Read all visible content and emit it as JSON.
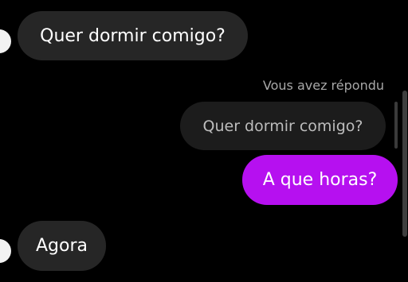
{
  "thread": {
    "messages": [
      {
        "sender": "other",
        "text": "Quer dormir comigo?"
      },
      {
        "sender": "me",
        "reply_label": "Vous avez répondu",
        "quoted_text": "Quer dormir comigo?",
        "text": "A que horas?",
        "bubble_color": "#b610f0"
      },
      {
        "sender": "other",
        "text": "Agora"
      }
    ]
  },
  "colors": {
    "background": "#000000",
    "received_bubble": "#262626",
    "quoted_bubble": "#1c1c1c",
    "sent_bubble": "#b610f0"
  }
}
